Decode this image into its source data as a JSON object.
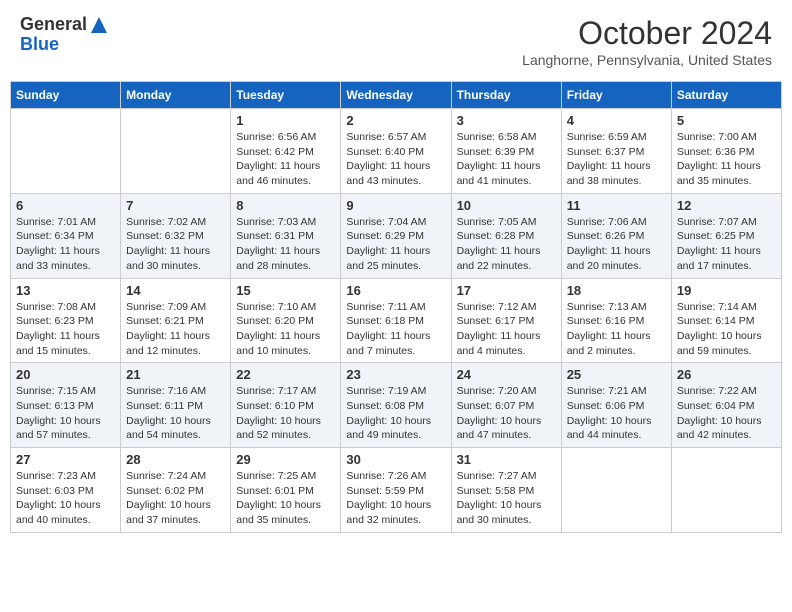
{
  "header": {
    "logo_line1": "General",
    "logo_line2": "Blue",
    "month": "October 2024",
    "location": "Langhorne, Pennsylvania, United States"
  },
  "days_of_week": [
    "Sunday",
    "Monday",
    "Tuesday",
    "Wednesday",
    "Thursday",
    "Friday",
    "Saturday"
  ],
  "weeks": [
    [
      {
        "day": "",
        "info": ""
      },
      {
        "day": "",
        "info": ""
      },
      {
        "day": "1",
        "info": "Sunrise: 6:56 AM\nSunset: 6:42 PM\nDaylight: 11 hours and 46 minutes."
      },
      {
        "day": "2",
        "info": "Sunrise: 6:57 AM\nSunset: 6:40 PM\nDaylight: 11 hours and 43 minutes."
      },
      {
        "day": "3",
        "info": "Sunrise: 6:58 AM\nSunset: 6:39 PM\nDaylight: 11 hours and 41 minutes."
      },
      {
        "day": "4",
        "info": "Sunrise: 6:59 AM\nSunset: 6:37 PM\nDaylight: 11 hours and 38 minutes."
      },
      {
        "day": "5",
        "info": "Sunrise: 7:00 AM\nSunset: 6:36 PM\nDaylight: 11 hours and 35 minutes."
      }
    ],
    [
      {
        "day": "6",
        "info": "Sunrise: 7:01 AM\nSunset: 6:34 PM\nDaylight: 11 hours and 33 minutes."
      },
      {
        "day": "7",
        "info": "Sunrise: 7:02 AM\nSunset: 6:32 PM\nDaylight: 11 hours and 30 minutes."
      },
      {
        "day": "8",
        "info": "Sunrise: 7:03 AM\nSunset: 6:31 PM\nDaylight: 11 hours and 28 minutes."
      },
      {
        "day": "9",
        "info": "Sunrise: 7:04 AM\nSunset: 6:29 PM\nDaylight: 11 hours and 25 minutes."
      },
      {
        "day": "10",
        "info": "Sunrise: 7:05 AM\nSunset: 6:28 PM\nDaylight: 11 hours and 22 minutes."
      },
      {
        "day": "11",
        "info": "Sunrise: 7:06 AM\nSunset: 6:26 PM\nDaylight: 11 hours and 20 minutes."
      },
      {
        "day": "12",
        "info": "Sunrise: 7:07 AM\nSunset: 6:25 PM\nDaylight: 11 hours and 17 minutes."
      }
    ],
    [
      {
        "day": "13",
        "info": "Sunrise: 7:08 AM\nSunset: 6:23 PM\nDaylight: 11 hours and 15 minutes."
      },
      {
        "day": "14",
        "info": "Sunrise: 7:09 AM\nSunset: 6:21 PM\nDaylight: 11 hours and 12 minutes."
      },
      {
        "day": "15",
        "info": "Sunrise: 7:10 AM\nSunset: 6:20 PM\nDaylight: 11 hours and 10 minutes."
      },
      {
        "day": "16",
        "info": "Sunrise: 7:11 AM\nSunset: 6:18 PM\nDaylight: 11 hours and 7 minutes."
      },
      {
        "day": "17",
        "info": "Sunrise: 7:12 AM\nSunset: 6:17 PM\nDaylight: 11 hours and 4 minutes."
      },
      {
        "day": "18",
        "info": "Sunrise: 7:13 AM\nSunset: 6:16 PM\nDaylight: 11 hours and 2 minutes."
      },
      {
        "day": "19",
        "info": "Sunrise: 7:14 AM\nSunset: 6:14 PM\nDaylight: 10 hours and 59 minutes."
      }
    ],
    [
      {
        "day": "20",
        "info": "Sunrise: 7:15 AM\nSunset: 6:13 PM\nDaylight: 10 hours and 57 minutes."
      },
      {
        "day": "21",
        "info": "Sunrise: 7:16 AM\nSunset: 6:11 PM\nDaylight: 10 hours and 54 minutes."
      },
      {
        "day": "22",
        "info": "Sunrise: 7:17 AM\nSunset: 6:10 PM\nDaylight: 10 hours and 52 minutes."
      },
      {
        "day": "23",
        "info": "Sunrise: 7:19 AM\nSunset: 6:08 PM\nDaylight: 10 hours and 49 minutes."
      },
      {
        "day": "24",
        "info": "Sunrise: 7:20 AM\nSunset: 6:07 PM\nDaylight: 10 hours and 47 minutes."
      },
      {
        "day": "25",
        "info": "Sunrise: 7:21 AM\nSunset: 6:06 PM\nDaylight: 10 hours and 44 minutes."
      },
      {
        "day": "26",
        "info": "Sunrise: 7:22 AM\nSunset: 6:04 PM\nDaylight: 10 hours and 42 minutes."
      }
    ],
    [
      {
        "day": "27",
        "info": "Sunrise: 7:23 AM\nSunset: 6:03 PM\nDaylight: 10 hours and 40 minutes."
      },
      {
        "day": "28",
        "info": "Sunrise: 7:24 AM\nSunset: 6:02 PM\nDaylight: 10 hours and 37 minutes."
      },
      {
        "day": "29",
        "info": "Sunrise: 7:25 AM\nSunset: 6:01 PM\nDaylight: 10 hours and 35 minutes."
      },
      {
        "day": "30",
        "info": "Sunrise: 7:26 AM\nSunset: 5:59 PM\nDaylight: 10 hours and 32 minutes."
      },
      {
        "day": "31",
        "info": "Sunrise: 7:27 AM\nSunset: 5:58 PM\nDaylight: 10 hours and 30 minutes."
      },
      {
        "day": "",
        "info": ""
      },
      {
        "day": "",
        "info": ""
      }
    ]
  ]
}
